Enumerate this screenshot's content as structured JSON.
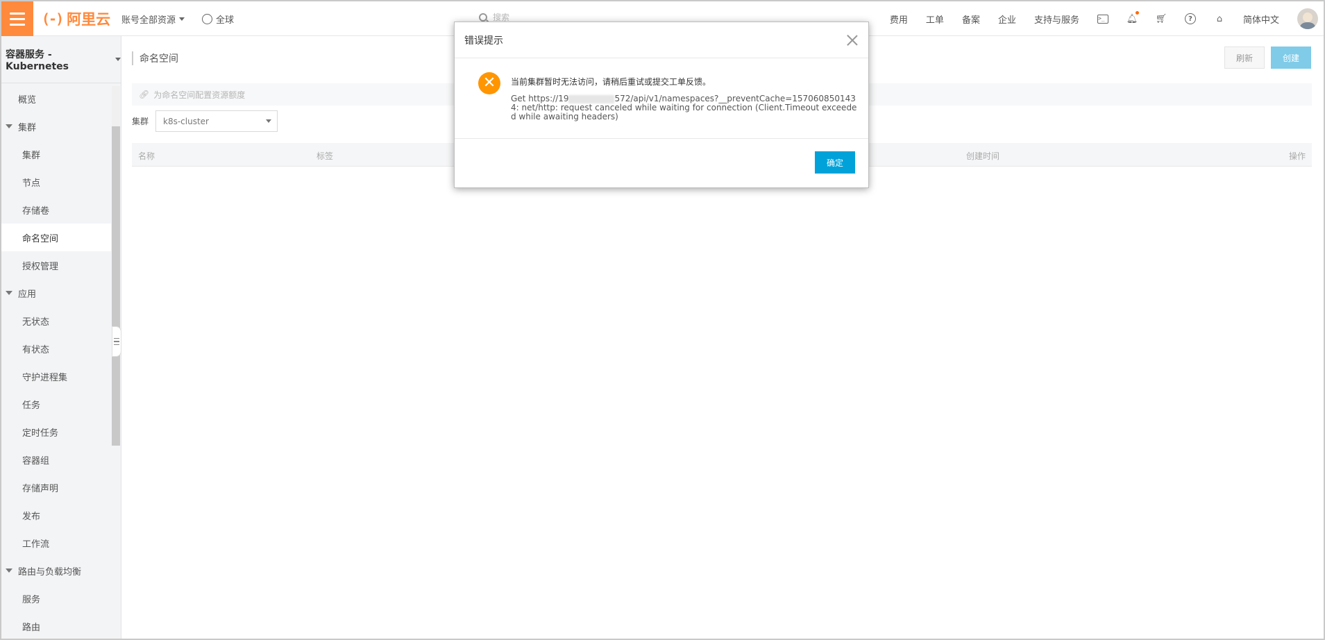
{
  "header": {
    "logo_text": "阿里云",
    "account_resources": "账号全部资源",
    "region": "全球",
    "search_placeholder": "搜索",
    "links": [
      "费用",
      "工单",
      "备案",
      "企业",
      "支持与服务"
    ],
    "language": "简体中文",
    "icons": [
      "terminal-icon",
      "bell-icon",
      "cart-icon",
      "help-icon",
      "home-icon"
    ]
  },
  "sidebar": {
    "title": "容器服务 - Kubernetes",
    "overview": "概览",
    "groups": [
      {
        "label": "集群",
        "items": [
          "集群",
          "节点",
          "存储卷",
          "命名空间",
          "授权管理"
        ]
      },
      {
        "label": "应用",
        "items": [
          "无状态",
          "有状态",
          "守护进程集",
          "任务",
          "定时任务",
          "容器组",
          "存储声明",
          "发布",
          "工作流"
        ]
      },
      {
        "label": "路由与负载均衡",
        "items": [
          "服务",
          "路由"
        ]
      }
    ],
    "active_item": "命名空间"
  },
  "main": {
    "page_title": "命名空间",
    "refresh_label": "刷新",
    "create_label": "创建",
    "tip_text": "为命名空间配置资源额度",
    "filter_label": "集群",
    "cluster_value": "k8s-cluster",
    "table_headers": {
      "name": "名称",
      "labels": "标签",
      "created": "创建时间",
      "actions": "操作"
    }
  },
  "modal": {
    "title": "错误提示",
    "message": "当前集群暂时无法访问，请稍后重试或提交工单反馈。",
    "detail_prefix": "Get https://19",
    "detail_suffix": "572/api/v1/namespaces?__preventCache=1570608501434: net/http: request canceled while waiting for connection (Client.Timeout exceeded while awaiting headers)",
    "ok_label": "确定"
  },
  "colors": {
    "brand": "#ff8a3d",
    "primary_button": "#00a2d9",
    "disabled_create": "#7fcbe8",
    "error_icon": "#ff9500"
  }
}
